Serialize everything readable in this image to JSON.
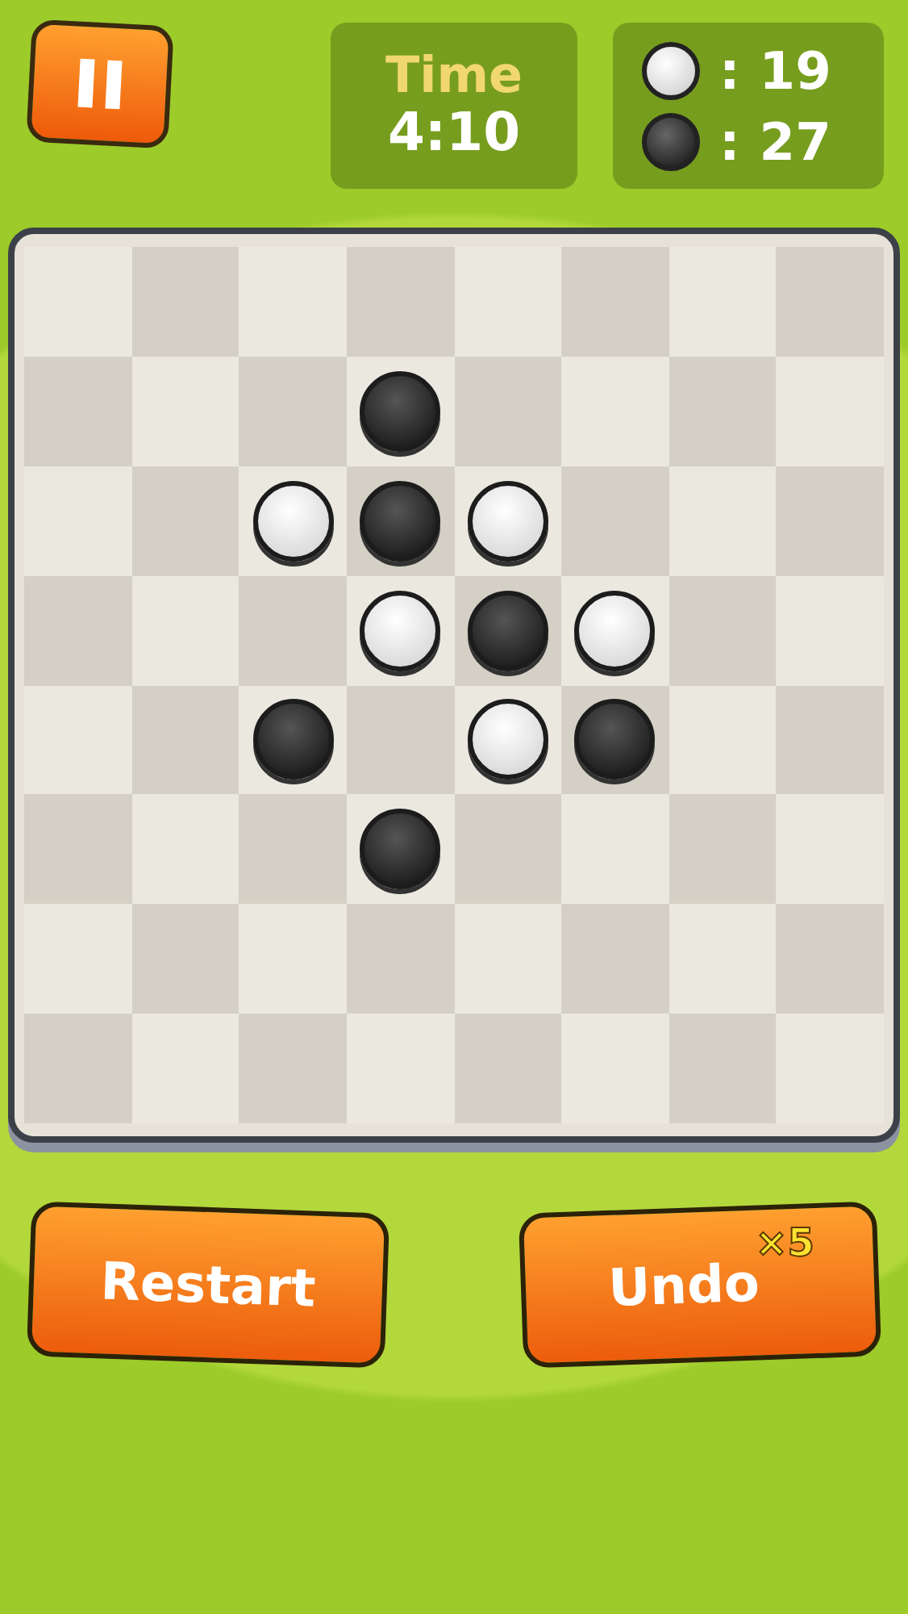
{
  "timer": {
    "label": "Time",
    "value": "4:10"
  },
  "score": [
    {
      "kind": "white",
      "separator": ":",
      "count": "19"
    },
    {
      "kind": "black",
      "separator": ":",
      "count": "27"
    }
  ],
  "board": {
    "rows": [
      [
        {
          "kind": "empty"
        },
        {
          "kind": "empty"
        },
        {
          "kind": "empty"
        },
        {
          "kind": "empty"
        },
        {
          "kind": "empty"
        },
        {
          "kind": "empty"
        },
        {
          "kind": "empty"
        },
        {
          "kind": "empty"
        }
      ],
      [
        {
          "kind": "empty"
        },
        {
          "kind": "empty"
        },
        {
          "kind": "empty"
        },
        {
          "kind": "black"
        },
        {
          "kind": "empty"
        },
        {
          "kind": "empty"
        },
        {
          "kind": "empty"
        },
        {
          "kind": "empty"
        }
      ],
      [
        {
          "kind": "empty"
        },
        {
          "kind": "empty"
        },
        {
          "kind": "white"
        },
        {
          "kind": "black"
        },
        {
          "kind": "white"
        },
        {
          "kind": "empty"
        },
        {
          "kind": "empty"
        },
        {
          "kind": "empty"
        }
      ],
      [
        {
          "kind": "empty"
        },
        {
          "kind": "empty"
        },
        {
          "kind": "empty"
        },
        {
          "kind": "white"
        },
        {
          "kind": "black"
        },
        {
          "kind": "white"
        },
        {
          "kind": "empty"
        },
        {
          "kind": "empty"
        }
      ],
      [
        {
          "kind": "empty"
        },
        {
          "kind": "empty"
        },
        {
          "kind": "black"
        },
        {
          "kind": "empty"
        },
        {
          "kind": "white"
        },
        {
          "kind": "black"
        },
        {
          "kind": "empty"
        },
        {
          "kind": "empty"
        }
      ],
      [
        {
          "kind": "empty"
        },
        {
          "kind": "empty"
        },
        {
          "kind": "empty"
        },
        {
          "kind": "black"
        },
        {
          "kind": "empty"
        },
        {
          "kind": "empty"
        },
        {
          "kind": "empty"
        },
        {
          "kind": "empty"
        }
      ],
      [
        {
          "kind": "empty"
        },
        {
          "kind": "empty"
        },
        {
          "kind": "empty"
        },
        {
          "kind": "empty"
        },
        {
          "kind": "empty"
        },
        {
          "kind": "empty"
        },
        {
          "kind": "empty"
        },
        {
          "kind": "empty"
        }
      ],
      [
        {
          "kind": "empty"
        },
        {
          "kind": "empty"
        },
        {
          "kind": "empty"
        },
        {
          "kind": "empty"
        },
        {
          "kind": "empty"
        },
        {
          "kind": "empty"
        },
        {
          "kind": "empty"
        },
        {
          "kind": "empty"
        }
      ]
    ]
  },
  "buttons": {
    "restart": "Restart",
    "undo": "Undo",
    "undo_count": "×5"
  }
}
